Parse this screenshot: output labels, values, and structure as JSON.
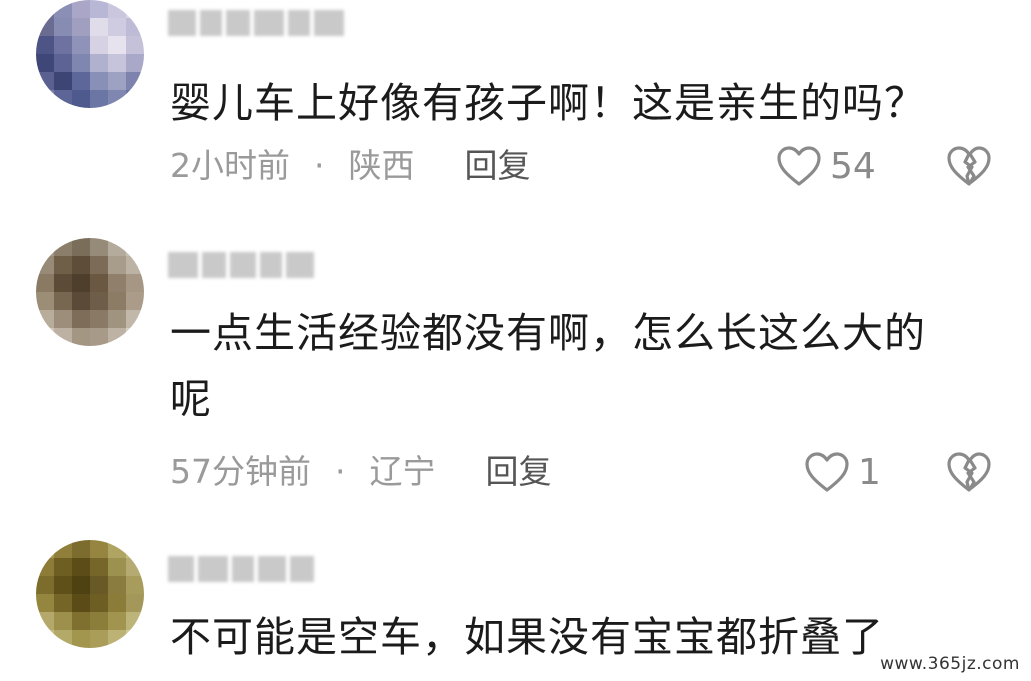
{
  "comments": [
    {
      "text": "婴儿车上好像有孩子啊！这是亲生的吗？",
      "time": "2小时前",
      "location": "陕西",
      "reply_label": "回复",
      "likes": "54",
      "avatar_colors": [
        "#6f7194",
        "#8c8fb5",
        "#a9a6c8",
        "#b8b7d6",
        "#c9c6dd",
        "#d9d6e6",
        "#6a6c92",
        "#878cb2",
        "#a19fc0",
        "#e0dcea",
        "#cfcbe0",
        "#bdbbd5",
        "#4f5486",
        "#6d72a0",
        "#8f92b9",
        "#d6d2e4",
        "#e6e3ee",
        "#c4c1d9",
        "#3f4778",
        "#5d6394",
        "#7f86b0",
        "#b0b0cf",
        "#c6c4db",
        "#a9a8c8",
        "#5a6191",
        "#3d4575",
        "#5d679a",
        "#8890b8",
        "#9da2c3",
        "#7e83ad",
        "#7a80a8",
        "#5c6595",
        "#4e5a8e",
        "#6c76a4",
        "#7f87b0",
        "#6a719d"
      ],
      "name_blocks": [
        28,
        22,
        24,
        30,
        22,
        30
      ]
    },
    {
      "text": "一点生活经验都没有啊，怎么长这么大的\n呢",
      "time": "57分钟前",
      "location": "辽宁",
      "reply_label": "回复",
      "likes": "1",
      "avatar_colors": [
        "#a29a8c",
        "#8b7f6c",
        "#7a6d5a",
        "#968a78",
        "#b5ab9c",
        "#c9c0b3",
        "#978b77",
        "#6f5f49",
        "#5e4e39",
        "#7c6c57",
        "#a89c8a",
        "#bdb3a5",
        "#8a7a64",
        "#5c4b36",
        "#4e3f2d",
        "#6a5843",
        "#907f6a",
        "#a59784",
        "#9c8d77",
        "#776650",
        "#5a4a37",
        "#6e5d48",
        "#8c7c66",
        "#aa9c88",
        "#b8ac9b",
        "#9c8e7b",
        "#7e6e59",
        "#8a7a65",
        "#a09380",
        "#c2b8aa",
        "#cfc7bb",
        "#bcb1a2",
        "#a39682",
        "#a89a88",
        "#bdb2a3",
        "#d6cfc5"
      ],
      "name_blocks": [
        30,
        24,
        26,
        22,
        28
      ]
    },
    {
      "text": "不可能是空车，如果没有宝宝都折叠了",
      "avatar_colors": [
        "#a89a55",
        "#8f7f3a",
        "#7c6c2e",
        "#958540",
        "#b0a463",
        "#c3ba80",
        "#8c7c38",
        "#6e5e22",
        "#5c4d18",
        "#76662a",
        "#9d9150",
        "#b5ab72",
        "#7c6d2c",
        "#5f5019",
        "#4e4112",
        "#685926",
        "#8a7c3e",
        "#a89c5c",
        "#94863f",
        "#756628",
        "#5b4c17",
        "#6d5e23",
        "#8b7d39",
        "#a3975a",
        "#b4a86a",
        "#9d904c",
        "#7f7030",
        "#8b7d3a",
        "#a0944f",
        "#bdb47a",
        "#c6bd86",
        "#b3a968",
        "#a2964f",
        "#a99d59",
        "#bcb274",
        "#d0c898"
      ],
      "name_blocks": [
        26,
        30,
        22,
        28,
        24
      ]
    }
  ],
  "watermark": "www.365jz.com"
}
